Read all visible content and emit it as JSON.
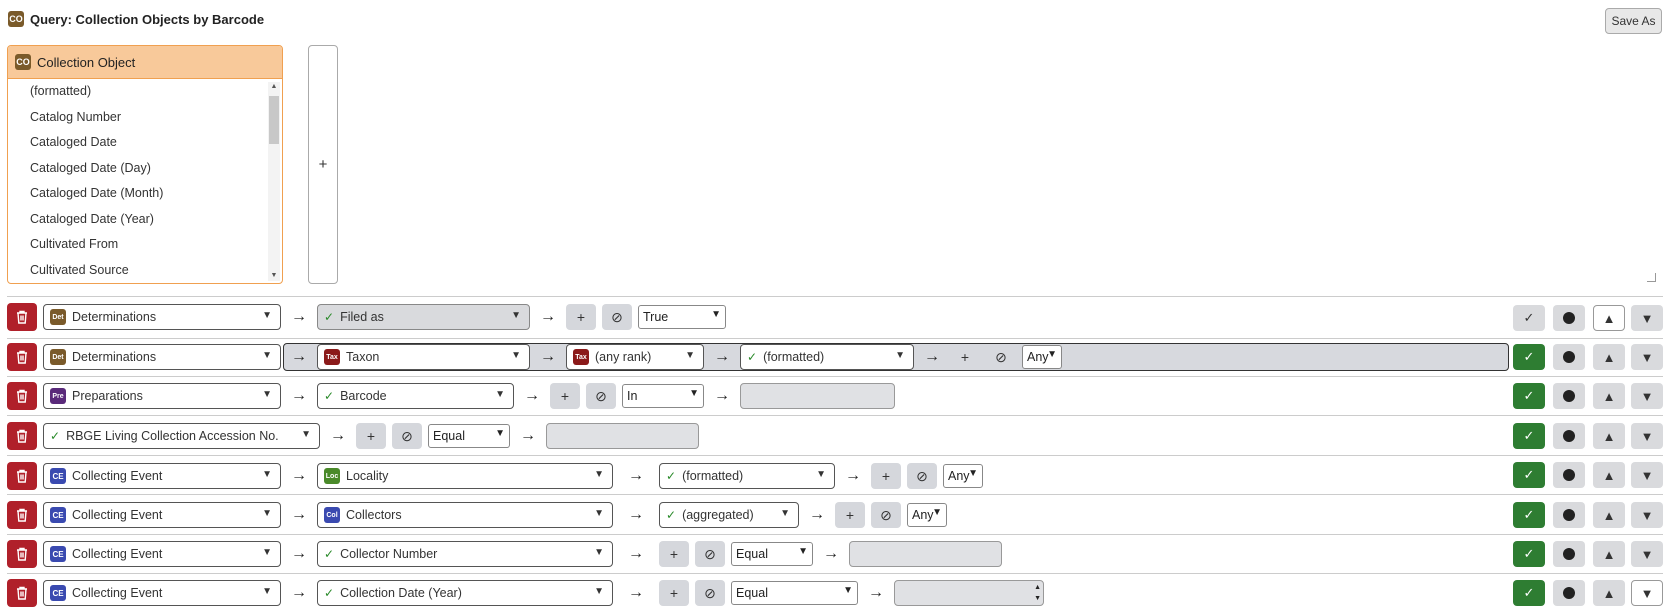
{
  "header": {
    "icon": "CO",
    "title": "Query: Collection Objects by Barcode",
    "save_as": "Save As"
  },
  "picker": {
    "icon": "CO",
    "table": "Collection Object",
    "items": [
      "(formatted)",
      "Catalog Number",
      "Cataloged Date",
      "Cataloged Date (Day)",
      "Cataloged Date (Month)",
      "Cataloged Date (Year)",
      "Cultivated From",
      "Cultivated Source"
    ]
  },
  "add_label": "+",
  "arrow": "→",
  "rows": [
    {
      "table_icon": "Det",
      "table": "Determinations",
      "f2": "Filed as",
      "op": "True"
    },
    {
      "table_icon": "Det",
      "table": "Determinations",
      "f2_icon": "Tax",
      "f2": "Taxon",
      "f3_icon": "Tax",
      "f3": "(any rank)",
      "f4": "(formatted)",
      "op": "Any"
    },
    {
      "table_icon": "Pre",
      "table": "Preparations",
      "f2": "Barcode",
      "op": "In"
    },
    {
      "table": "RBGE Living Collection Accession No.",
      "op": "Equal"
    },
    {
      "table_icon": "CE",
      "table": "Collecting Event",
      "f2_icon": "Loc",
      "f2": "Locality",
      "f3": "(formatted)",
      "op": "Any"
    },
    {
      "table_icon": "CE",
      "table": "Collecting Event",
      "f2_icon": "Col",
      "f2": "Collectors",
      "f3": "(aggregated)",
      "op": "Any"
    },
    {
      "table_icon": "CE",
      "table": "Collecting Event",
      "f2": "Collector Number",
      "op": "Equal"
    },
    {
      "table_icon": "CE",
      "table": "Collecting Event",
      "f2": "Collection Date (Year)",
      "op": "Equal"
    }
  ],
  "colors": {
    "delete": "#b0202a",
    "show": "#2e7d32",
    "picker_head": "#f8c99a",
    "picker_border": "#f0a050"
  }
}
